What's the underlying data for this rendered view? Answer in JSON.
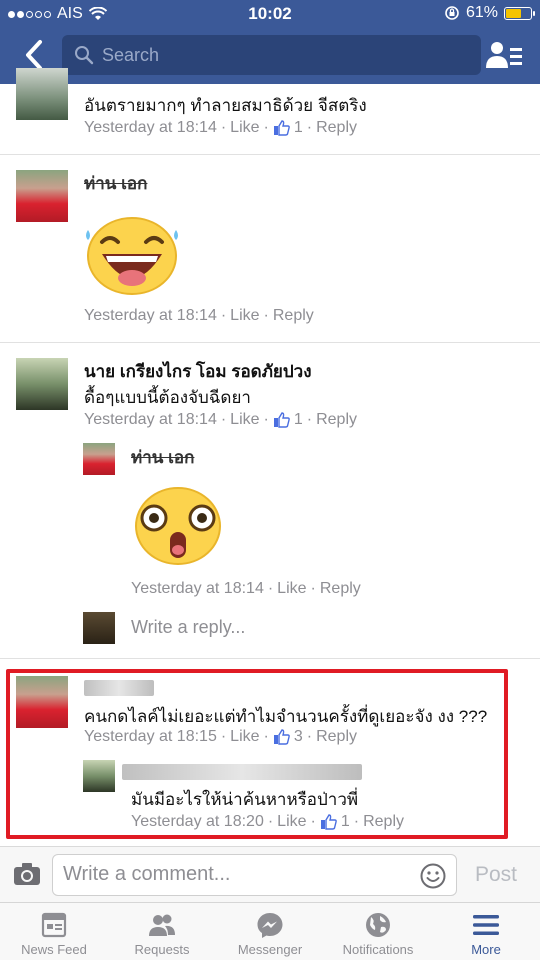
{
  "status_bar": {
    "carrier": "AIS",
    "time": "10:02",
    "battery": "61%",
    "battery_level": 0.61,
    "signal_bars_filled": 2
  },
  "header": {
    "search_placeholder": "Search"
  },
  "comments": [
    {
      "text": "อันตรายมากๆ ทำลายสมาธิด้วย จีสตริง",
      "time": "Yesterday at 18:14",
      "like_label": "Like",
      "reply_label": "Reply",
      "likes": "1"
    },
    {
      "author": "ท่าน เอก",
      "time": "Yesterday at 18:14",
      "like_label": "Like",
      "reply_label": "Reply",
      "sticker": "laughing-tears"
    },
    {
      "author": "นาย เกรียงไกร โอม รอดภัยปวง",
      "text": "ดื้อๆแบบนี้ต้องจับฉีดยา",
      "time": "Yesterday at 18:14",
      "like_label": "Like",
      "reply_label": "Reply",
      "likes": "1",
      "reply": {
        "author": "ท่าน เอก",
        "time": "Yesterday at 18:14",
        "like_label": "Like",
        "reply_label": "Reply",
        "sticker": "shocked-face"
      },
      "write_reply_placeholder": "Write a reply..."
    },
    {
      "text": "คนกดไลค์ไม่เยอะแต่ทำไมจำนวนครั้งที่ดูเยอะจัง งง ???",
      "time": "Yesterday at 18:15",
      "like_label": "Like",
      "reply_label": "Reply",
      "likes": "3",
      "reply": {
        "text": "มันมีอะไรให้น่าค้นหาหรือป่าวพี่",
        "time": "Yesterday at 18:20",
        "like_label": "Like",
        "reply_label": "Reply",
        "likes": "1"
      }
    }
  ],
  "comment_bar": {
    "placeholder": "Write a comment...",
    "post_label": "Post"
  },
  "tabs": [
    {
      "label": "News Feed",
      "icon": "news-feed-icon"
    },
    {
      "label": "Requests",
      "icon": "friend-requests-icon"
    },
    {
      "label": "Messenger",
      "icon": "messenger-icon"
    },
    {
      "label": "Notifications",
      "icon": "globe-icon"
    },
    {
      "label": "More",
      "icon": "menu-icon",
      "active": true
    }
  ],
  "colors": {
    "brand": "#3b5998",
    "highlight": "#e01b24",
    "meta_text": "#8e8e93"
  }
}
